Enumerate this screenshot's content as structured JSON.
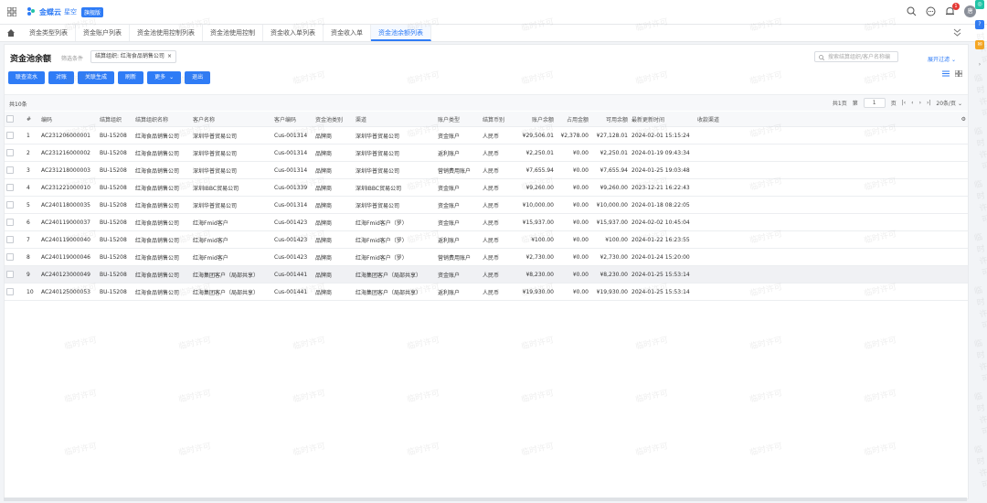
{
  "header": {
    "brand": "金蝶云",
    "product": "星空",
    "edition": "旗舰版",
    "notification_count": "1",
    "avatar_initial": "唐"
  },
  "tabs": [
    {
      "label": "资金类型列表",
      "active": false
    },
    {
      "label": "资金账户列表",
      "active": false
    },
    {
      "label": "资金池使用控制列表",
      "active": false
    },
    {
      "label": "资金池使用控制",
      "active": false
    },
    {
      "label": "资金收入单列表",
      "active": false
    },
    {
      "label": "资金收入单",
      "active": false
    },
    {
      "label": "资金池余额列表",
      "active": true
    }
  ],
  "page": {
    "title": "资金池余额",
    "filter_label": "筛选条件",
    "filter_chip": "结算组织: 红海食品销售公司",
    "search_placeholder": "搜索结算组织/客户名称编",
    "expand_filter": "展开过滤"
  },
  "toolbar": {
    "buttons": [
      "联查流水",
      "对账",
      "关联生成",
      "刷新",
      "更多",
      "退出"
    ]
  },
  "pager": {
    "total": "共10条",
    "pages": "共1页",
    "page_prefix": "第",
    "page_value": "1",
    "page_suffix": "页",
    "page_size": "20条/页"
  },
  "table": {
    "columns": [
      "#",
      "编码",
      "结算组织",
      "结算组织名称",
      "客户名称",
      "客户编码",
      "资金池类别",
      "渠道",
      "账户类型",
      "结算币别",
      "账户余额",
      "占用金额",
      "可用余额",
      "最新更新时间",
      "收款渠道"
    ],
    "rows": [
      [
        "1",
        "AC231206000001",
        "BU-15208",
        "红海食品销售公司",
        "深圳华普贸易公司",
        "Cus-001314",
        "品牌商",
        "深圳华普贸易公司",
        "资金账户",
        "人民币",
        "¥29,506.01",
        "¥2,378.00",
        "¥27,128.01",
        "2024-02-01 15:15:24",
        ""
      ],
      [
        "2",
        "AC231216000002",
        "BU-15208",
        "红海食品销售公司",
        "深圳华普贸易公司",
        "Cus-001314",
        "品牌商",
        "深圳华普贸易公司",
        "返利账户",
        "人民币",
        "¥2,250.01",
        "¥0.00",
        "¥2,250.01",
        "2024-01-19 09:43:34",
        ""
      ],
      [
        "3",
        "AC231218000003",
        "BU-15208",
        "红海食品销售公司",
        "深圳华普贸易公司",
        "Cus-001314",
        "品牌商",
        "深圳华普贸易公司",
        "营销费用账户",
        "人民币",
        "¥7,655.94",
        "¥0.00",
        "¥7,655.94",
        "2024-01-25 19:03:48",
        ""
      ],
      [
        "4",
        "AC231221000010",
        "BU-15208",
        "红海食品销售公司",
        "深圳IBBC贸易公司",
        "Cus-001339",
        "品牌商",
        "深圳IBBC贸易公司",
        "资金账户",
        "人民币",
        "¥9,260.00",
        "¥0.00",
        "¥9,260.00",
        "2023-12-21 16:22:43",
        ""
      ],
      [
        "5",
        "AC240118000035",
        "BU-15208",
        "红海食品销售公司",
        "深圳华普贸易公司",
        "Cus-001314",
        "品牌商",
        "深圳华普贸易公司",
        "资金账户",
        "人民币",
        "¥10,000.00",
        "¥0.00",
        "¥10,000.00",
        "2024-01-18 08:22:05",
        ""
      ],
      [
        "6",
        "AC240119000037",
        "BU-15208",
        "红海食品销售公司",
        "红海Fmid客户",
        "Cus-001423",
        "品牌商",
        "红海Fmid客户（罗）",
        "资金账户",
        "人民币",
        "¥15,937.00",
        "¥0.00",
        "¥15,937.00",
        "2024-02-02 10:45:04",
        ""
      ],
      [
        "7",
        "AC240119000040",
        "BU-15208",
        "红海食品销售公司",
        "红海Fmid客户",
        "Cus-001423",
        "品牌商",
        "红海Fmid客户（罗）",
        "返利账户",
        "人民币",
        "¥100.00",
        "¥0.00",
        "¥100.00",
        "2024-01-22 16:23:55",
        ""
      ],
      [
        "8",
        "AC240119000046",
        "BU-15208",
        "红海食品销售公司",
        "红海Fmid客户",
        "Cus-001423",
        "品牌商",
        "红海Fmid客户（罗）",
        "营销费用账户",
        "人民币",
        "¥2,730.00",
        "¥0.00",
        "¥2,730.00",
        "2024-01-24 15:20:00",
        ""
      ],
      [
        "9",
        "AC240123000049",
        "BU-15208",
        "红海食品销售公司",
        "红海集团客户（局部共享）",
        "Cus-001441",
        "品牌商",
        "红海集团客户（局部共享）",
        "资金账户",
        "人民币",
        "¥8,230.00",
        "¥0.00",
        "¥8,230.00",
        "2024-01-25 15:53:14",
        ""
      ],
      [
        "10",
        "AC240125000053",
        "BU-15208",
        "红海食品销售公司",
        "红海集团客户（局部共享）",
        "Cus-001441",
        "品牌商",
        "红海集团客户（局部共享）",
        "返利账户",
        "人民币",
        "¥19,930.00",
        "¥0.00",
        "¥19,930.00",
        "2024-01-25 15:53:14",
        ""
      ]
    ]
  },
  "watermark_text": "临时许可",
  "colors": {
    "accent": "#2f7cf6",
    "badge": "#e53935",
    "float_green": "#22c3a6",
    "float_blue": "#2f7cf6",
    "float_orange": "#f5a623"
  }
}
